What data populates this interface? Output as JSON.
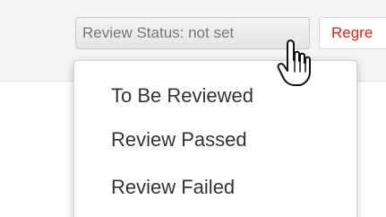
{
  "toolbar": {
    "review_status_label": "Review Status: not set",
    "regress_label": "Regre"
  },
  "dropdown": {
    "items": [
      {
        "label": "To Be Reviewed"
      },
      {
        "label": "Review Passed"
      },
      {
        "label": "Review Failed"
      }
    ]
  },
  "colors": {
    "regress_text": "#e0231b",
    "button_text": "#777777",
    "menu_text": "#333333"
  },
  "icons": {
    "cursor": "pointing-hand-cursor-icon"
  }
}
